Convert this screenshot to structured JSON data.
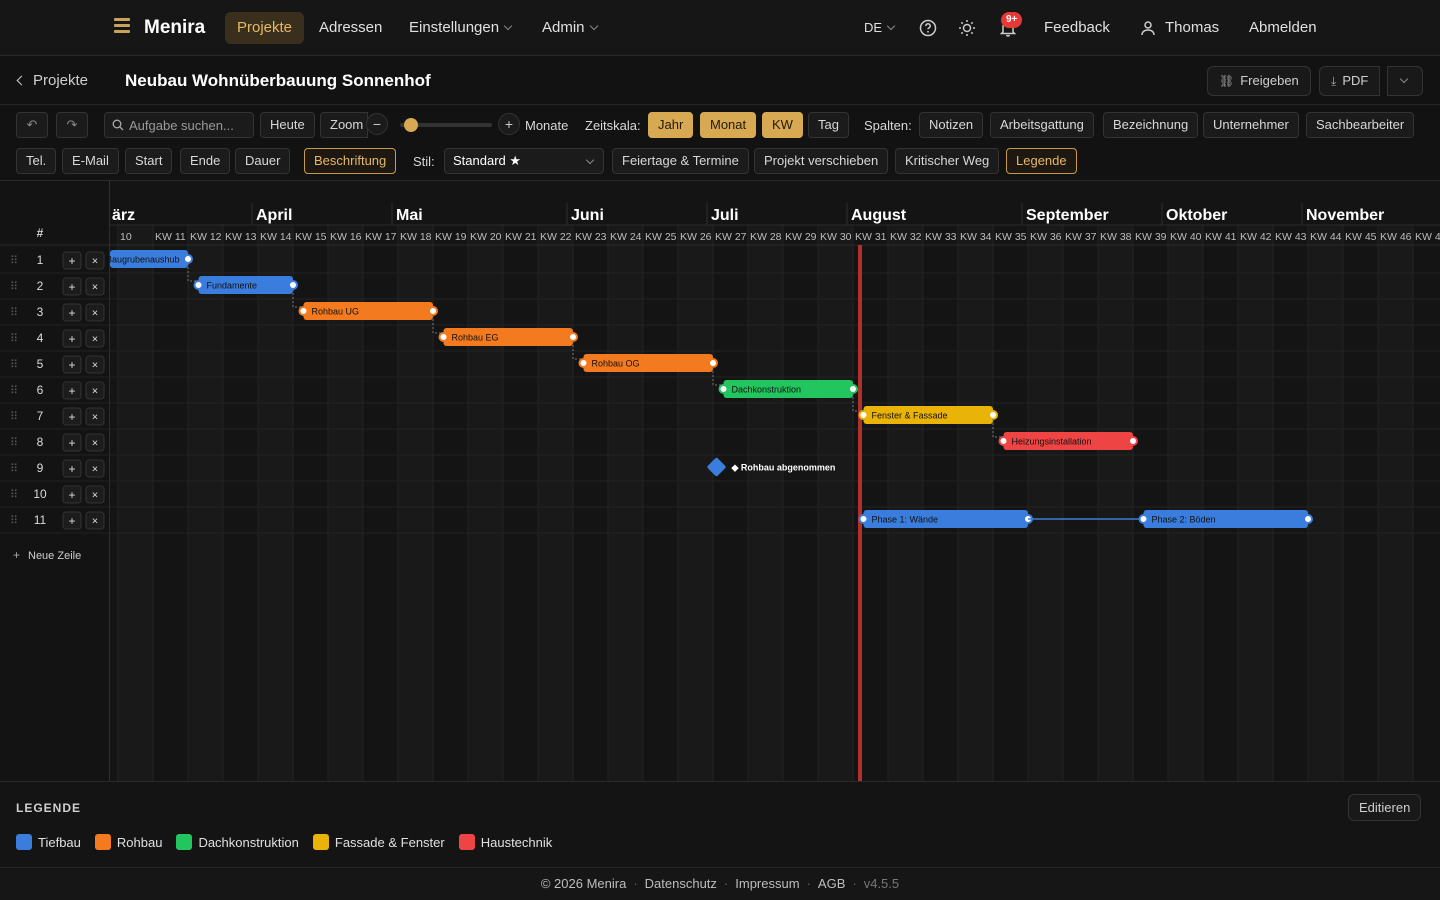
{
  "app": {
    "brand": "Menira"
  },
  "nav": {
    "items": [
      "Projekte",
      "Adressen",
      "Einstellungen",
      "Admin"
    ],
    "lang": "DE",
    "notif_badge": "9+",
    "feedback": "Feedback",
    "user": "Thomas",
    "logout": "Abmelden"
  },
  "project": {
    "back": "Projekte",
    "title": "Neubau Wohnüberbauung Sonnenhof",
    "share": "Freigeben",
    "pdf": "PDF"
  },
  "toolbar": {
    "search_placeholder": "Aufgabe suchen...",
    "today": "Heute",
    "zoom": "Zoom",
    "zoom_unit": "Monate",
    "zoom_level": 0.05,
    "scale_label": "Zeitskala:",
    "scales": [
      "Jahr",
      "Monat",
      "KW",
      "Tag"
    ],
    "columns_label": "Spalten:",
    "columns": [
      "Notizen",
      "Arbeitsgattung",
      "Bezeichnung",
      "Unternehmer",
      "Sachbearbeiter",
      "Tel.",
      "E-Mail",
      "Start",
      "Ende",
      "Dauer"
    ],
    "labeling": "Beschriftung",
    "style_label": "Stil:",
    "style_value": "Standard ★",
    "holidays": "Feiertage & Termine",
    "move": "Projekt verschieben",
    "critical": "Kritischer Weg",
    "legend": "Legende"
  },
  "gantt": {
    "row_header": "#",
    "new_row": "Neue Zeile",
    "months": [
      {
        "label": "ärz",
        "start": 10
      },
      {
        "label": "April",
        "start": 14
      },
      {
        "label": "Mai",
        "start": 18
      },
      {
        "label": "Juni",
        "start": 23
      },
      {
        "label": "Juli",
        "start": 27
      },
      {
        "label": "August",
        "start": 31
      },
      {
        "label": "September",
        "start": 36
      },
      {
        "label": "Oktober",
        "start": 40
      },
      {
        "label": "November",
        "start": 44
      }
    ],
    "week_start": 10,
    "week_end": 48,
    "today_week": 31.2,
    "rows": [
      {
        "n": "1",
        "bars": [
          {
            "label": "Baugrubenaushub",
            "start": 9.5,
            "end": 12,
            "color": "#3b7ddd"
          }
        ]
      },
      {
        "n": "2",
        "bars": [
          {
            "label": "Fundamente",
            "start": 12.3,
            "end": 15,
            "color": "#3b7ddd"
          }
        ]
      },
      {
        "n": "3",
        "bars": [
          {
            "label": "Rohbau UG",
            "start": 15.3,
            "end": 19,
            "color": "#f47a1f"
          }
        ]
      },
      {
        "n": "4",
        "bars": [
          {
            "label": "Rohbau EG",
            "start": 19.3,
            "end": 23,
            "color": "#f47a1f"
          }
        ]
      },
      {
        "n": "5",
        "bars": [
          {
            "label": "Rohbau OG",
            "start": 23.3,
            "end": 27,
            "color": "#f47a1f"
          }
        ]
      },
      {
        "n": "6",
        "bars": [
          {
            "label": "Dachkonstruktion",
            "start": 27.3,
            "end": 31,
            "color": "#22c55e"
          }
        ]
      },
      {
        "n": "7",
        "bars": [
          {
            "label": "Fenster & Fassade",
            "start": 31.3,
            "end": 35,
            "color": "#eab308"
          }
        ]
      },
      {
        "n": "8",
        "bars": [
          {
            "label": "Heizungsinstallation",
            "start": 35.3,
            "end": 39,
            "color": "#ef4444"
          }
        ]
      },
      {
        "n": "9",
        "milestone": {
          "label": "◆ Rohbau abgenommen",
          "week": 27.1,
          "color": "#3b7ddd"
        }
      },
      {
        "n": "10"
      },
      {
        "n": "11",
        "bars": [
          {
            "label": "Phase 1: Wände",
            "start": 31.3,
            "end": 36,
            "color": "#3b7ddd"
          },
          {
            "label": "Phase 2: Böden",
            "start": 39.3,
            "end": 44,
            "color": "#3b7ddd"
          }
        ]
      }
    ]
  },
  "legend": {
    "title": "LEGENDE",
    "edit": "Editieren",
    "items": [
      {
        "label": "Tiefbau",
        "color": "#3b7ddd"
      },
      {
        "label": "Rohbau",
        "color": "#f47a1f"
      },
      {
        "label": "Dachkonstruktion",
        "color": "#22c55e"
      },
      {
        "label": "Fassade & Fenster",
        "color": "#eab308"
      },
      {
        "label": "Haustechnik",
        "color": "#ef4444"
      }
    ]
  },
  "footer": {
    "copyright": "© 2026 Menira",
    "privacy": "Datenschutz",
    "imprint": "Impressum",
    "terms": "AGB",
    "version": "v4.5.5"
  }
}
